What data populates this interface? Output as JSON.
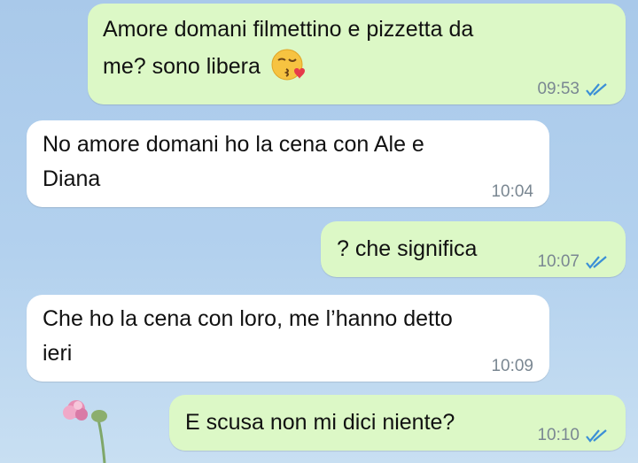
{
  "messages": [
    {
      "text_line1": "Amore domani filmettino e pizzetta da",
      "text_line2": "me? sono libera",
      "emoji": "kissing-face-emoji",
      "time": "09:53",
      "direction": "outgoing",
      "status": "read"
    },
    {
      "text_line1": "No amore domani ho la cena con Ale e",
      "text_line2": "Diana",
      "time": "10:04",
      "direction": "incoming"
    },
    {
      "text": "? che significa",
      "time": "10:07",
      "direction": "outgoing",
      "status": "read"
    },
    {
      "text_line1": "Che ho la cena con loro, me l’hanno detto",
      "text_line2": "ieri",
      "time": "10:09",
      "direction": "incoming"
    },
    {
      "text": "E scusa non mi dici niente?",
      "time": "10:10",
      "direction": "outgoing",
      "status": "read"
    }
  ],
  "colors": {
    "outgoing_bubble": "#dcf8c6",
    "incoming_bubble": "#ffffff",
    "read_ticks": "#3b8fd6",
    "wallpaper": "#b3d1ee"
  }
}
